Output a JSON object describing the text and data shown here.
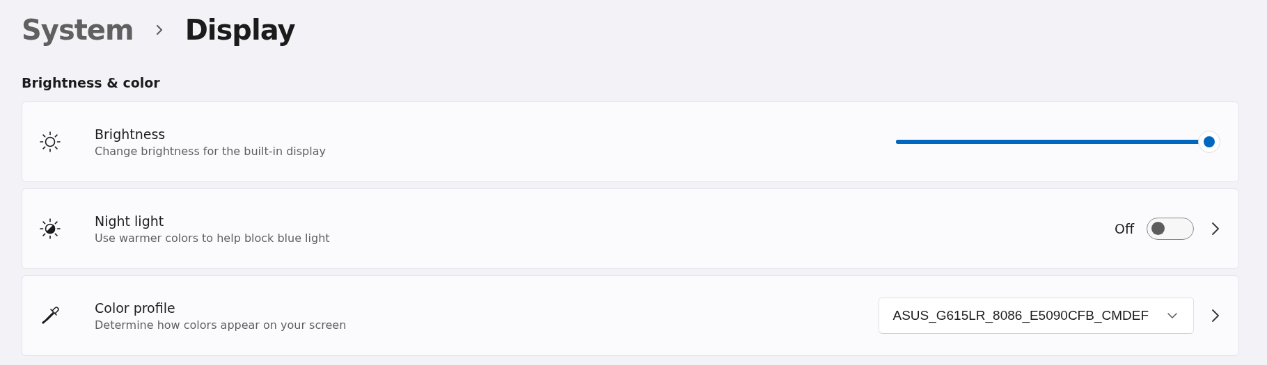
{
  "breadcrumb": [
    {
      "label": "System",
      "current": false
    },
    {
      "label": "Display",
      "current": true
    }
  ],
  "section_title": "Brightness & color",
  "settings": [
    {
      "kind": "slider",
      "title": "Brightness",
      "subtitle": "Change brightness for the built-in display",
      "level": 1.0
    },
    {
      "kind": "toggle",
      "title": "Night light",
      "subtitle": "Use warmer colors to help block blue light",
      "state_label": "Off",
      "on": false
    },
    {
      "kind": "dropdown",
      "title": "Color profile",
      "subtitle": "Determine how colors appear on your screen",
      "value": "ASUS_G615LR_8086_E5090CFB_CMDEF"
    }
  ]
}
